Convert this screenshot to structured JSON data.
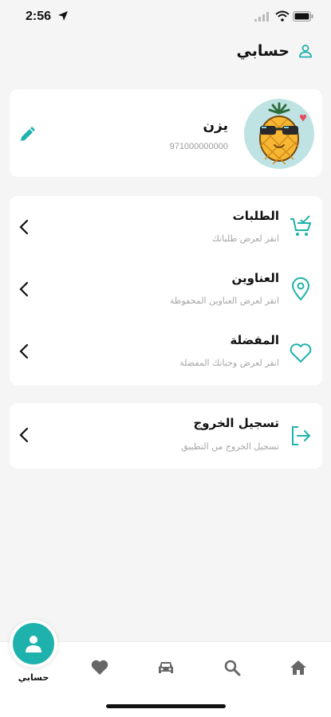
{
  "status": {
    "time": "2:56"
  },
  "header": {
    "title": "حسابي",
    "icon": "user-icon"
  },
  "profile": {
    "name": "يزن",
    "phone": "971000000000",
    "avatar": "pineapple-avatar",
    "edit_icon": "pencil-icon"
  },
  "menu": [
    {
      "title": "الطلبات",
      "subtitle": "انقر لعرض طلباتك",
      "icon": "cart-check-icon"
    },
    {
      "title": "العناوين",
      "subtitle": "انقر لعرض العناوين المحفوظة",
      "icon": "location-pin-icon"
    },
    {
      "title": "المفضلة",
      "subtitle": "انقر لعرض وجباتك المفضلة",
      "icon": "heart-outline-icon"
    }
  ],
  "logout": {
    "title": "تسجيل الخروج",
    "subtitle": "تسجيل الخروج من التطبيق",
    "icon": "logout-icon"
  },
  "tabbar": {
    "active_label": "حسابي",
    "tabs": [
      "user-icon",
      "heart-icon",
      "car-icon",
      "search-icon",
      "home-icon"
    ]
  },
  "colors": {
    "accent": "#1fb2ad",
    "background": "#f5f5f5",
    "card": "#ffffff",
    "subtitle": "#a6a6a6"
  }
}
